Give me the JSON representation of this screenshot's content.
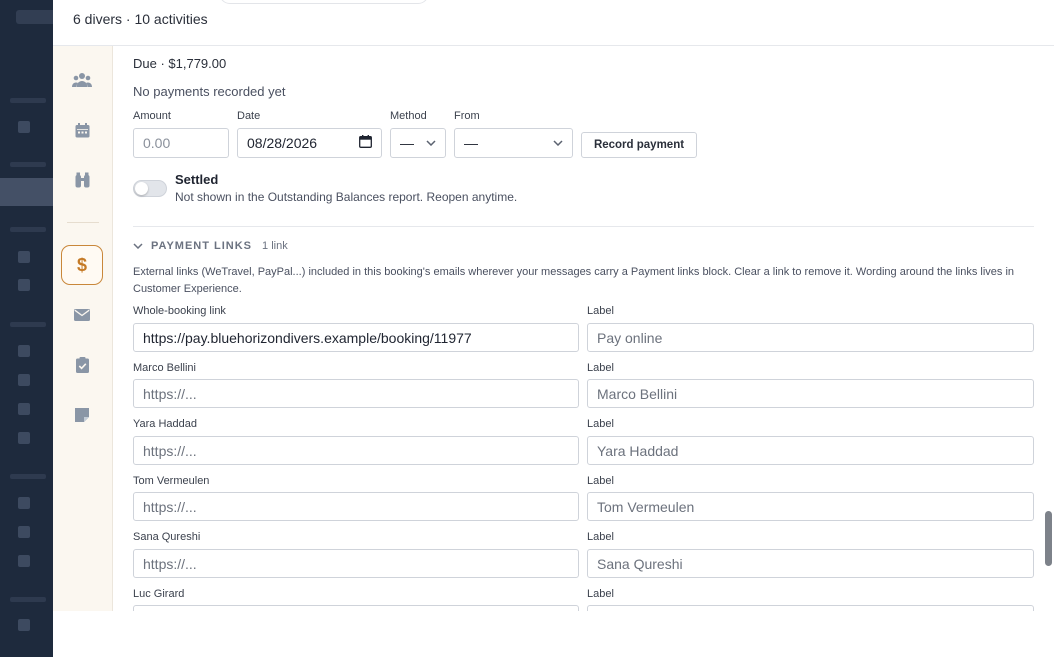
{
  "header": {
    "subtitle": "6 divers · 10 activities"
  },
  "rail": {
    "items": [
      {
        "name": "divers",
        "icon": "people-icon"
      },
      {
        "name": "calendar",
        "icon": "calendar-icon"
      },
      {
        "name": "gear",
        "icon": "binoculars-icon"
      },
      {
        "name": "payments",
        "icon": "dollar-icon",
        "glyph": "$",
        "active": true
      },
      {
        "name": "email",
        "icon": "envelope-icon"
      },
      {
        "name": "checklist",
        "icon": "clipboard-check-icon"
      },
      {
        "name": "notes",
        "icon": "note-icon"
      }
    ]
  },
  "payment": {
    "due": "Due · $1,779.00",
    "no_payments": "No payments recorded yet",
    "amount_label": "Amount",
    "amount_placeholder": "0.00",
    "date_label": "Date",
    "date_value": "08/28/2026",
    "method_label": "Method",
    "method_value": "—",
    "from_label": "From",
    "from_value": "—",
    "record_button": "Record payment"
  },
  "settled": {
    "title": "Settled",
    "description": "Not shown in the Outstanding Balances report. Reopen anytime."
  },
  "payment_links": {
    "title": "PAYMENT LINKS",
    "count": "1 link",
    "description": "External links (WeTravel, PayPal...) included in this booking's emails wherever your messages carry a Payment links block. Clear a link to remove it. Wording around the links lives in Customer Experience.",
    "label_heading": "Label",
    "rows": [
      {
        "name": "Whole-booking link",
        "url": "https://pay.bluehorizondivers.example/booking/11977",
        "label": "Pay online",
        "url_is_placeholder": false
      },
      {
        "name": "Marco Bellini",
        "url": "https://...",
        "label": "Marco Bellini",
        "url_is_placeholder": true
      },
      {
        "name": "Yara Haddad",
        "url": "https://...",
        "label": "Yara Haddad",
        "url_is_placeholder": true
      },
      {
        "name": "Tom Vermeulen",
        "url": "https://...",
        "label": "Tom Vermeulen",
        "url_is_placeholder": true
      },
      {
        "name": "Sana Qureshi",
        "url": "https://...",
        "label": "Sana Qureshi",
        "url_is_placeholder": true
      },
      {
        "name": "Luc Girard",
        "url": "",
        "label": "",
        "url_is_placeholder": true
      }
    ]
  },
  "colors": {
    "accent": "#c57a26",
    "backdrop": "#1e2a3d",
    "rail_bg": "#fbf7f0"
  }
}
